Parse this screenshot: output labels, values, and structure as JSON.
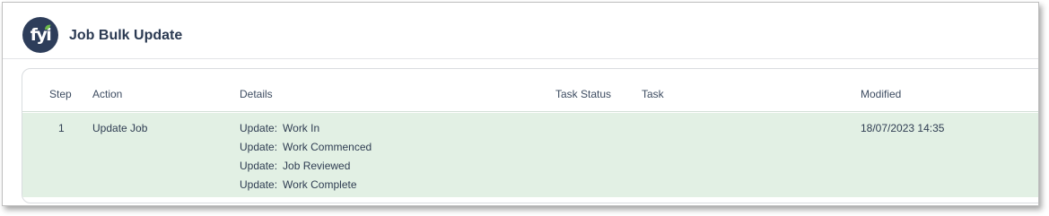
{
  "app": {
    "logo_text": "fyi",
    "title": "Job Bulk Update",
    "accent": "#2d3d5a",
    "leaf_color": "#6dbb4a"
  },
  "table": {
    "columns": [
      "Step",
      "Action",
      "Details",
      "Task Status",
      "Task",
      "Modified"
    ],
    "rows": [
      {
        "step": "1",
        "action": "Update Job",
        "details": [
          {
            "prefix": "Update:",
            "value": "Work In"
          },
          {
            "prefix": "Update:",
            "value": "Work Commenced"
          },
          {
            "prefix": "Update:",
            "value": "Job Reviewed"
          },
          {
            "prefix": "Update:",
            "value": "Work Complete"
          }
        ],
        "task_status": "",
        "task": "",
        "modified": "18/07/2023 14:35",
        "row_color": "#e2f0e4"
      }
    ]
  }
}
